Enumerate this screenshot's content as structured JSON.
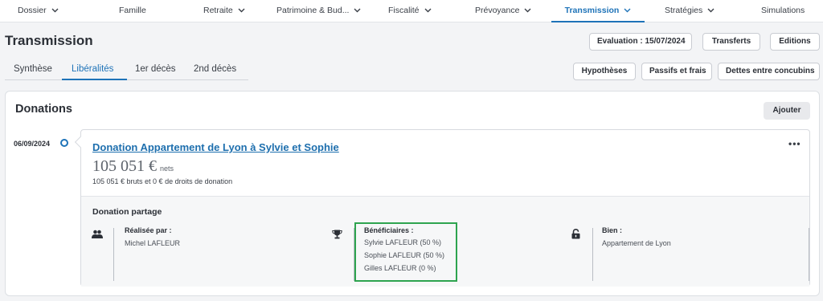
{
  "topnav": {
    "items": [
      {
        "label": "Dossier",
        "chevron": true
      },
      {
        "label": "Famille",
        "chevron": false
      },
      {
        "label": "Retraite",
        "chevron": true
      },
      {
        "label": "Patrimoine & Bud...",
        "chevron": true
      },
      {
        "label": "Fiscalité",
        "chevron": true
      },
      {
        "label": "Prévoyance",
        "chevron": true
      },
      {
        "label": "Transmission",
        "chevron": true,
        "active": true
      },
      {
        "label": "Stratégies",
        "chevron": true
      },
      {
        "label": "Simulations",
        "chevron": false
      }
    ],
    "accent_color": "#1e73b8"
  },
  "header": {
    "title": "Transmission",
    "evaluation_button": "Evaluation : 15/07/2024",
    "transferts_button": "Transferts",
    "editions_button": "Editions",
    "hypotheses_button": "Hypothèses",
    "passifs_button": "Passifs et frais",
    "dettes_button": "Dettes entre concubins"
  },
  "subtabs": {
    "items": [
      {
        "label": "Synthèse"
      },
      {
        "label": "Libéralités",
        "active": true
      },
      {
        "label": "1er décès"
      },
      {
        "label": "2nd décès"
      }
    ]
  },
  "donations": {
    "title": "Donations",
    "add_button": "Ajouter",
    "timeline_date": "06/09/2024",
    "item": {
      "title": "Donation Appartement de Lyon à Sylvie et Sophie",
      "menu": "•••",
      "amount": "105 051 €",
      "amount_suffix": "nets",
      "detail": "105 051 € bruts et 0 € de droits de donation",
      "type": "Donation partage",
      "realisee_label": "Réalisée par :",
      "realisee_value": "Michel LAFLEUR",
      "beneficiaires_label": "Bénéficiaires :",
      "beneficiaires": [
        "Sylvie LAFLEUR (50 %)",
        "Sophie LAFLEUR (50 %)",
        "Gilles LAFLEUR (0 %)"
      ],
      "bien_label": "Bien :",
      "bien_value": "Appartement de Lyon",
      "highlight_color": "#2ea44f"
    }
  }
}
